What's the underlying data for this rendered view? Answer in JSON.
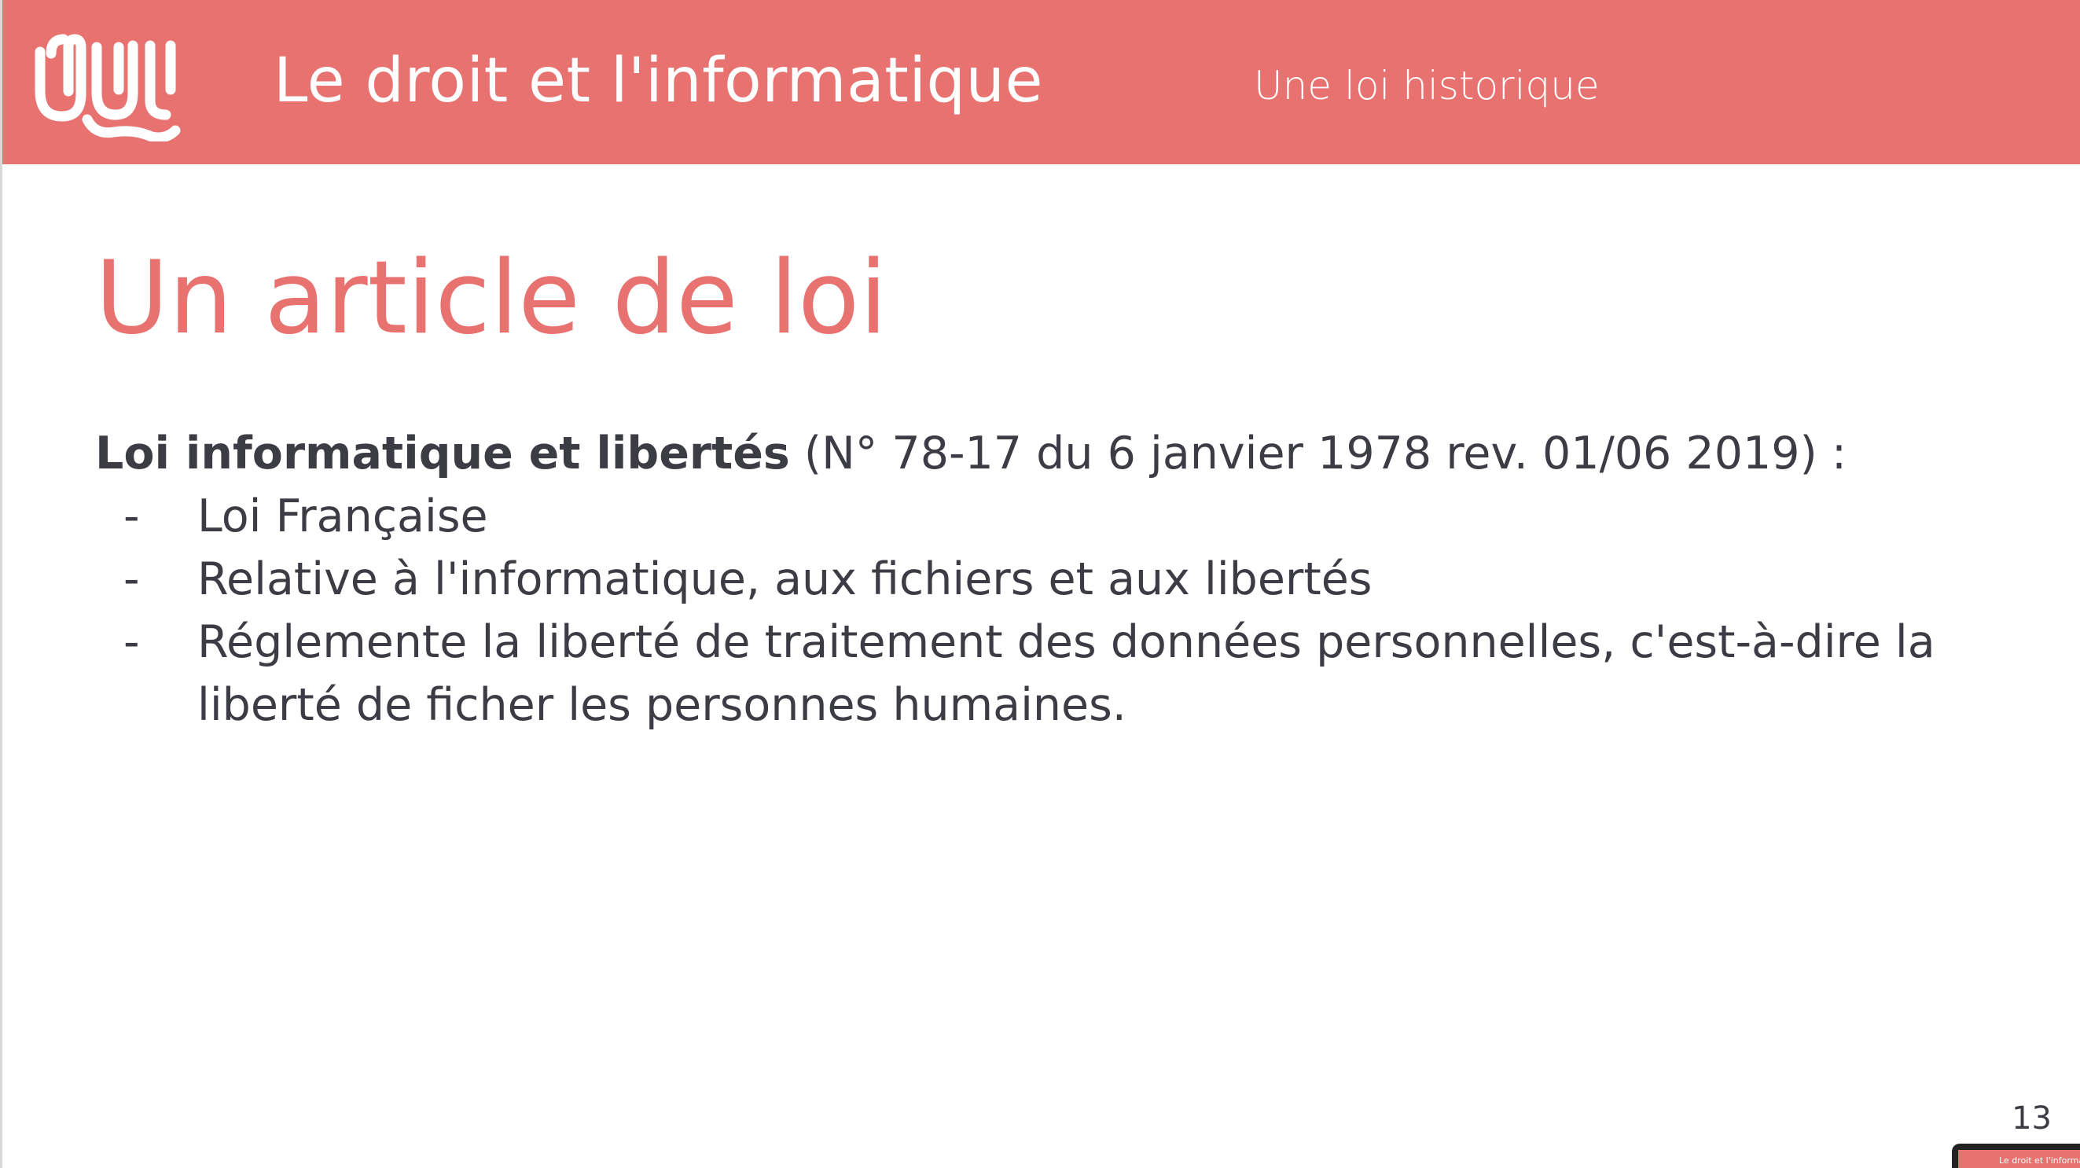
{
  "header": {
    "deck_title": "Le droit et l'informatique",
    "section_title": "Une loi historique",
    "logo_icon": "wave-logo-icon"
  },
  "slide": {
    "title": "Un article de loi",
    "lead_bold": "Loi informatique et libertés",
    "lead_rest": " (N° 78-17 du 6 janvier 1978 rev. 01/06 2019) :",
    "bullets": [
      "Loi Française",
      "Relative à l'informatique, aux fichiers et aux libertés",
      "Réglemente la liberté de traitement des données personnelles, c'est-à-dire la liberté de ficher les personnes humaines."
    ],
    "bullet_marker": "-",
    "page_number": "13"
  },
  "thumbnail": {
    "text": "Le droit et l'informati"
  },
  "colors": {
    "accent": "#e87270",
    "text": "#3c3c44",
    "background": "#ffffff"
  }
}
